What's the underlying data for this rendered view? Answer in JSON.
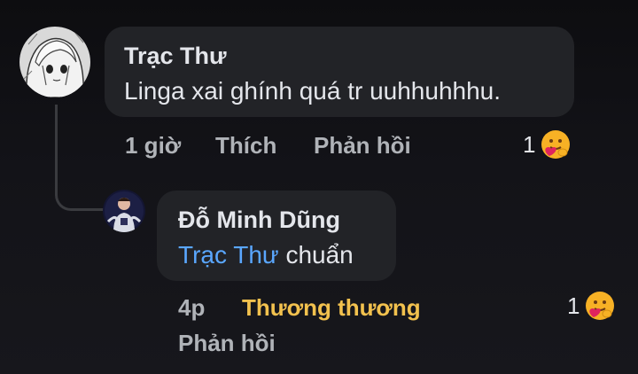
{
  "comments": [
    {
      "author": "Trạc Thư",
      "text": "Linga xai ghính quá tr uuhhuhhhu.",
      "time": "1 giờ",
      "like_label": "Thích",
      "reply_label": "Phản hồi",
      "reaction_count": "1",
      "reaction_icon": "care-reaction-icon"
    },
    {
      "author": "Đỗ Minh Dũng",
      "mention": "Trạc Thư",
      "text": "chuẩn",
      "time": "4p",
      "reaction_label": "Thương thương",
      "reply_label": "Phản hồi",
      "reaction_count": "1",
      "reaction_icon": "care-reaction-icon"
    }
  ],
  "colors": {
    "bubble": "#222327",
    "mention": "#5aa7ff",
    "reacted": "#f2c14e",
    "meta": "#b0b3b8"
  }
}
